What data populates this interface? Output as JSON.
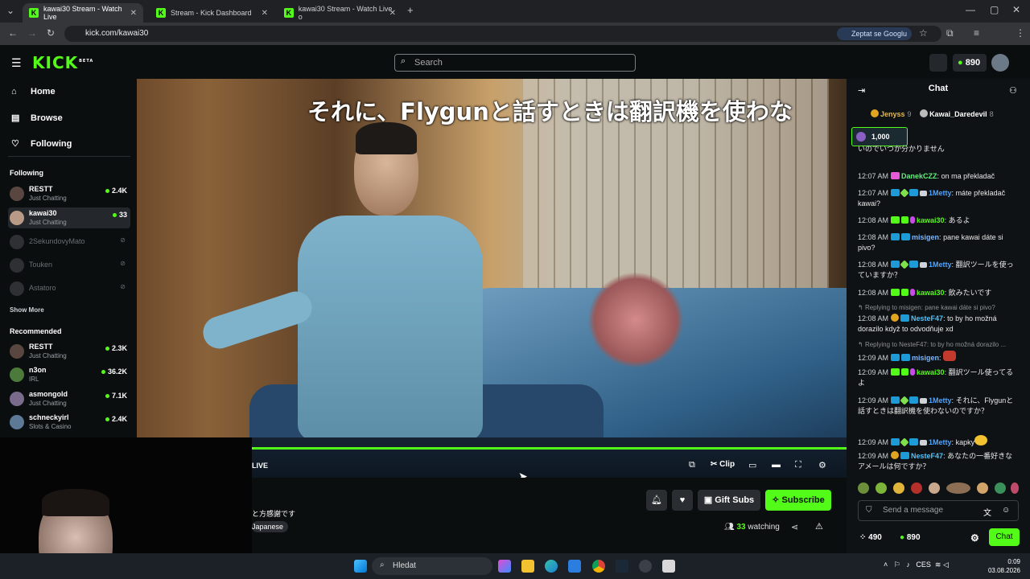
{
  "browser": {
    "tabs": [
      {
        "label": "kawai30 Stream - Watch Live"
      },
      {
        "label": "Stream - Kick Dashboard"
      },
      {
        "label": "kawai30 Stream - Watch Live o"
      }
    ],
    "url": "kick.com/kawai30",
    "ask_google": "Zeptat se Googlu"
  },
  "header": {
    "logo": "KICK",
    "logo_tag": "BETA",
    "search_placeholder": "Search",
    "points": "890"
  },
  "sidebar": {
    "nav": [
      {
        "label": "Home",
        "icon": "home-icon"
      },
      {
        "label": "Browse",
        "icon": "browse-icon"
      },
      {
        "label": "Following",
        "icon": "heart-icon"
      }
    ],
    "following_title": "Following",
    "following": [
      {
        "name": "RESTT",
        "category": "Just Chatting",
        "viewers": "2.4K"
      },
      {
        "name": "kawai30",
        "category": "Just Chatting",
        "viewers": "33"
      },
      {
        "name": "2SekundovyMato"
      },
      {
        "name": "Touken"
      },
      {
        "name": "Astatoro"
      }
    ],
    "show_more": "Show More",
    "recommended_title": "Recommended",
    "recommended": [
      {
        "name": "RESTT",
        "category": "Just Chatting",
        "viewers": "2.3K"
      },
      {
        "name": "n3on",
        "category": "IRL",
        "viewers": "36.2K"
      },
      {
        "name": "asmongold",
        "category": "Just Chatting",
        "viewers": "7.1K"
      },
      {
        "name": "schneckyirl",
        "category": "Slots & Casino",
        "viewers": "2.4K"
      }
    ]
  },
  "video": {
    "subtitle": "それに、Flygunと話すときは翻訳機を使わな",
    "live_label": "LIVE",
    "clip_label": "Clip"
  },
  "stream_info": {
    "title_fragment": "と方感謝です",
    "tag": "Japanese",
    "gift_subs": "Gift Subs",
    "subscribe": "Subscribe",
    "watching_count": "33",
    "watching_label": "watching"
  },
  "chat": {
    "title": "Chat",
    "leaderboard": [
      {
        "name": "Jenyss",
        "count": "9"
      },
      {
        "name": "Kawai_Daredevil",
        "count": "8"
      }
    ],
    "pinned_amount": "1,000",
    "messages": [
      {
        "time": "",
        "user": "",
        "text": "いのでいつか分かりません"
      },
      {
        "time": "12:07 AM",
        "user": "DanekCZZ",
        "text": "on ma překladač"
      },
      {
        "time": "12:07 AM",
        "user": "1Metty",
        "text": "máte překladač kawai?"
      },
      {
        "time": "12:08 AM",
        "user": "kawai30",
        "text": "あるよ"
      },
      {
        "time": "12:08 AM",
        "user": "misigen",
        "text": "pane kawai dáte si pivo?"
      },
      {
        "time": "12:08 AM",
        "user": "1Metty",
        "text": "翻訳ツールを使っていますか？"
      },
      {
        "time": "12:08 AM",
        "user": "kawai30",
        "text": "飲みたいです"
      },
      {
        "time": "12:08 AM",
        "user": "NesteF47",
        "text": "to by ho možná dorazilo když to odvodňuje xd",
        "reply": "Replying to misigen: pane kawai dáte si pivo?"
      },
      {
        "time": "12:09 AM",
        "user": "misigen",
        "text": "",
        "reply": "Replying to NesteF47: to by ho možná dorazilo ..."
      },
      {
        "time": "12:09 AM",
        "user": "kawai30",
        "text": "翻訳ツール使ってるよ"
      },
      {
        "time": "12:09 AM",
        "user": "1Metty",
        "text": "それに、Flygunと話すときは翻訳機を使わないのですか？"
      },
      {
        "time": "12:09 AM",
        "user": "1Metty",
        "text": "kapky"
      },
      {
        "time": "12:09 AM",
        "user": "NesteF47",
        "text": "あなたの一番好きなアメールは何ですか？"
      }
    ],
    "input_placeholder": "Send a message",
    "footer_left": "490",
    "footer_points": "890",
    "chat_button": "Chat"
  },
  "taskbar": {
    "search": "Hledat",
    "lang": "CES",
    "time": "0:09",
    "date": "03.08.2026"
  }
}
